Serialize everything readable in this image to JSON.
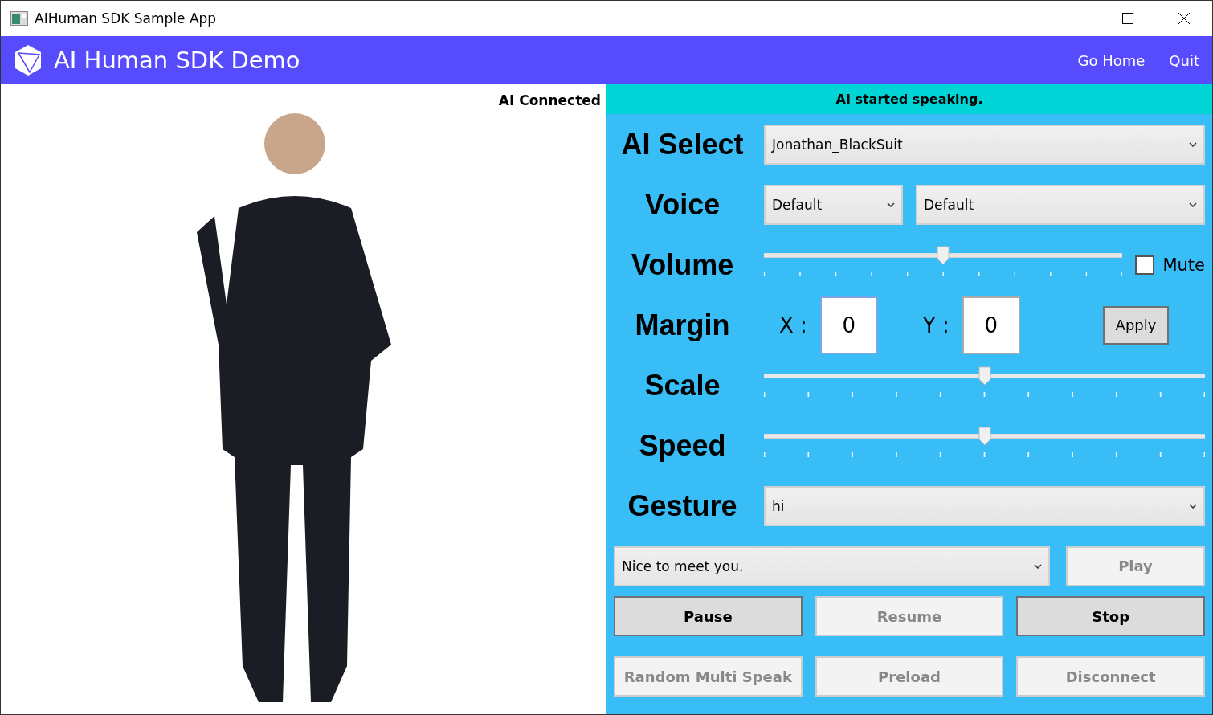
{
  "window": {
    "title": "AIHuman SDK Sample App"
  },
  "header": {
    "title": "AI Human SDK Demo",
    "nav": [
      "Go Home",
      "Quit"
    ]
  },
  "avatar_panel": {
    "status": "AI Connected"
  },
  "control_panel": {
    "status_message": "AI started speaking.",
    "rows": [
      {
        "kind": "select",
        "label": "AI Select",
        "value": "Jonathan_BlackSuit"
      },
      {
        "kind": "dual_select",
        "label": "Voice",
        "values": [
          "Default",
          "Default"
        ]
      },
      {
        "kind": "slider",
        "label": "Volume",
        "level": 0.5,
        "checkbox": {
          "label": "Mute",
          "checked": false
        }
      },
      {
        "kind": "margin",
        "label": "Margin",
        "x_label": "X :",
        "x_value": "0",
        "y_label": "Y :",
        "y_value": "0",
        "button": "Apply"
      },
      {
        "kind": "slider",
        "label": "Scale",
        "level": 0.5
      },
      {
        "kind": "slider",
        "label": "Speed",
        "level": 0.5
      },
      {
        "kind": "select",
        "label": "Gesture",
        "value": "hi"
      }
    ],
    "speech": {
      "value": "Nice to meet you.",
      "play": {
        "label": "Play",
        "disabled": true
      }
    },
    "buttons": [
      {
        "label": "Pause",
        "disabled": false
      },
      {
        "label": "Resume",
        "disabled": true
      },
      {
        "label": "Stop",
        "disabled": false
      },
      {
        "label": "Random Multi Speak",
        "disabled": true
      },
      {
        "label": "Preload",
        "disabled": true
      },
      {
        "label": "Disconnect",
        "disabled": true
      }
    ]
  }
}
